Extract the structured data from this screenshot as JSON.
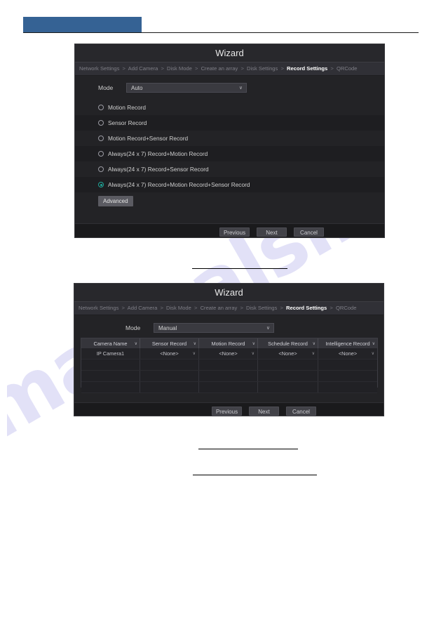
{
  "page": {
    "header_color": "#356294",
    "watermark_text": "manualslib.com"
  },
  "dialog1": {
    "title": "Wizard",
    "breadcrumbs": [
      {
        "label": "Network Settings",
        "active": false
      },
      {
        "label": "Add Camera",
        "active": false
      },
      {
        "label": "Disk Mode",
        "active": false
      },
      {
        "label": "Create an array",
        "active": false
      },
      {
        "label": "Disk Settings",
        "active": false
      },
      {
        "label": "Record Settings",
        "active": true
      },
      {
        "label": "QRCode",
        "active": false
      }
    ],
    "separator": ">",
    "mode": {
      "label": "Mode",
      "value": "Auto",
      "chevron": "∨"
    },
    "options": [
      {
        "label": "Motion Record",
        "selected": false
      },
      {
        "label": "Sensor Record",
        "selected": false
      },
      {
        "label": "Motion Record+Sensor Record",
        "selected": false
      },
      {
        "label": "Always(24 x 7) Record+Motion Record",
        "selected": false
      },
      {
        "label": "Always(24 x 7) Record+Sensor Record",
        "selected": false
      },
      {
        "label": "Always(24 x 7) Record+Motion Record+Sensor Record",
        "selected": true
      }
    ],
    "advanced_label": "Advanced",
    "buttons": {
      "previous": "Previous",
      "next": "Next",
      "cancel": "Cancel"
    }
  },
  "dialog2": {
    "title": "Wizard",
    "breadcrumbs": [
      {
        "label": "Network Settings",
        "active": false
      },
      {
        "label": "Add Camera",
        "active": false
      },
      {
        "label": "Disk Mode",
        "active": false
      },
      {
        "label": "Create an array",
        "active": false
      },
      {
        "label": "Disk Settings",
        "active": false
      },
      {
        "label": "Record Settings",
        "active": true
      },
      {
        "label": "QRCode",
        "active": false
      }
    ],
    "separator": ">",
    "mode": {
      "label": "Mode",
      "value": "Manual",
      "chevron": "∨"
    },
    "table": {
      "columns": [
        "Camera Name",
        "Sensor Record",
        "Motion Record",
        "Schedule Record",
        "Intelligence Record"
      ],
      "header_chevron": "∨",
      "cell_chevron": "∨",
      "rows": [
        [
          "IP Camera1",
          "<None>",
          "<None>",
          "<None>",
          "<None>"
        ]
      ],
      "empty_rows": 2
    },
    "buttons": {
      "previous": "Previous",
      "next": "Next",
      "cancel": "Cancel"
    }
  }
}
